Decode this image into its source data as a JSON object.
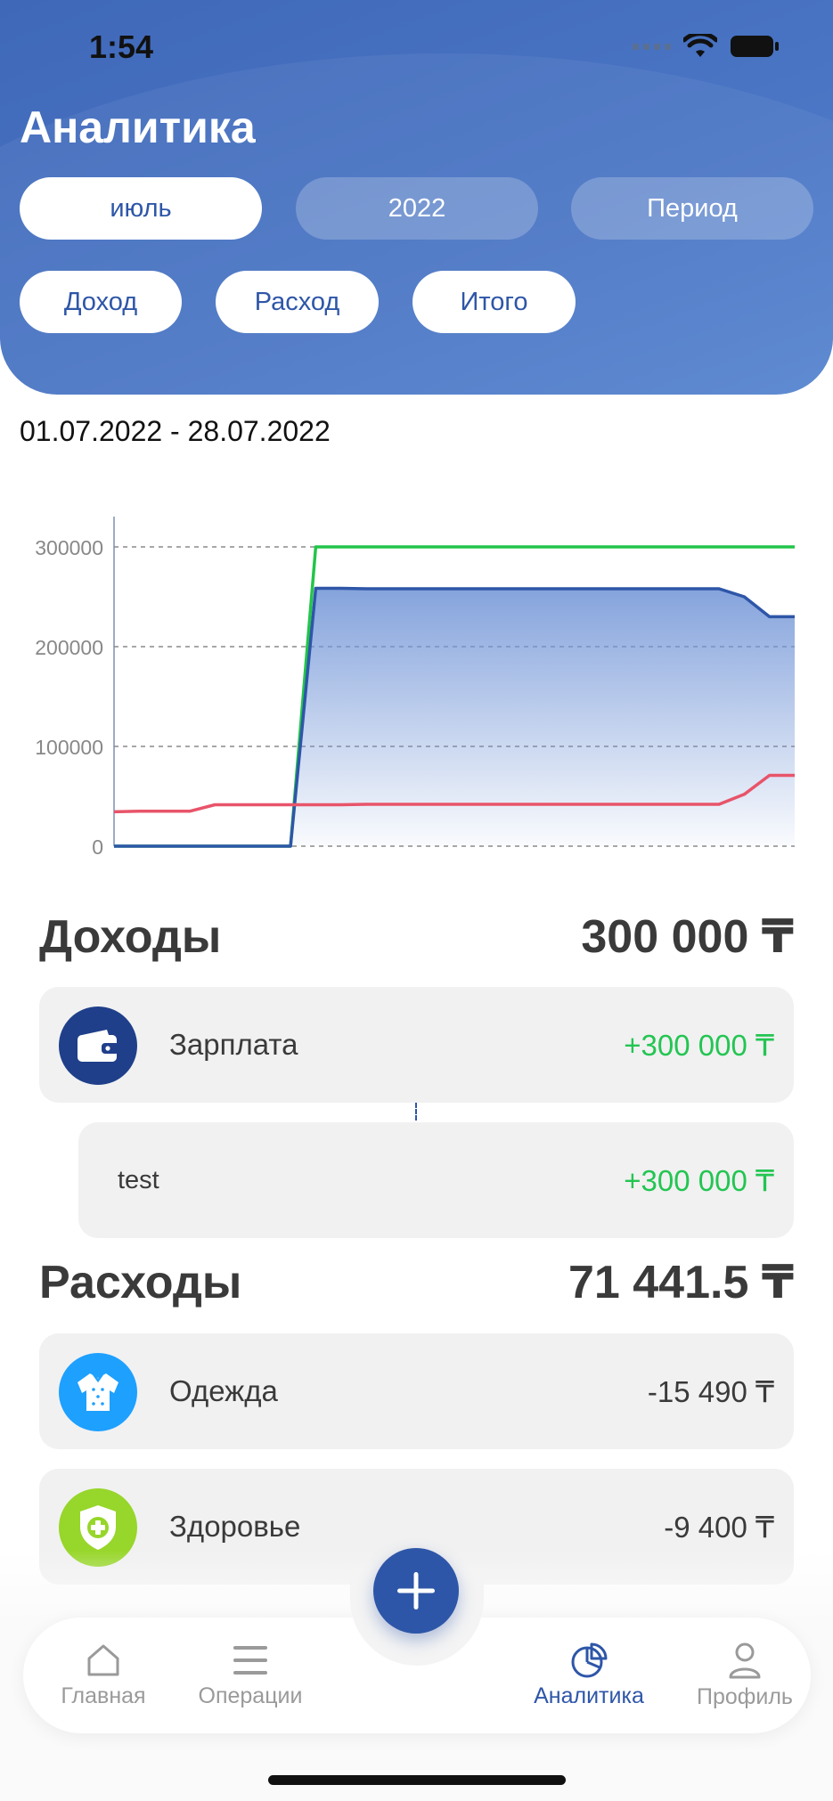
{
  "status_bar": {
    "time": "1:54"
  },
  "header": {
    "title": "Аналитика",
    "filters": {
      "month": "июль",
      "year": "2022",
      "period": "Период"
    },
    "types": {
      "income": "Доход",
      "expense": "Расход",
      "total": "Итого"
    }
  },
  "date_range": "01.07.2022 - 28.07.2022",
  "chart_data": {
    "type": "line",
    "y_ticks": [
      "300000",
      "200000",
      "100000",
      "0"
    ],
    "ylim": [
      0,
      300000
    ],
    "x": [
      1,
      2,
      3,
      4,
      5,
      6,
      7,
      8,
      9,
      10,
      11,
      12,
      13,
      14,
      15,
      16,
      17,
      18,
      19,
      20,
      21,
      22,
      23,
      24,
      25,
      26,
      27,
      28
    ],
    "series": [
      {
        "color": "#22c54a",
        "values": [
          0,
          0,
          0,
          0,
          0,
          0,
          0,
          0,
          300000,
          300000,
          300000,
          300000,
          300000,
          300000,
          300000,
          300000,
          300000,
          300000,
          300000,
          300000,
          300000,
          300000,
          300000,
          300000,
          300000,
          300000,
          300000,
          300000
        ]
      },
      {
        "color": "#2e56a8",
        "fill": true,
        "values": [
          0,
          0,
          0,
          0,
          0,
          0,
          0,
          0,
          258500,
          258500,
          258000,
          258000,
          258000,
          258000,
          258000,
          258000,
          258000,
          258000,
          258000,
          258000,
          258000,
          258000,
          258000,
          258000,
          258000,
          250000,
          230000,
          230000
        ]
      },
      {
        "color": "#e8546a",
        "values": [
          34500,
          35000,
          35000,
          35000,
          41500,
          41500,
          41500,
          41500,
          41500,
          41500,
          42000,
          42000,
          42000,
          42000,
          42000,
          42000,
          42000,
          42000,
          42000,
          42000,
          42000,
          42000,
          42000,
          42000,
          42000,
          52000,
          71000,
          71000
        ]
      }
    ],
    "grid": true
  },
  "income": {
    "title": "Доходы",
    "total": "300 000 ₸",
    "items": [
      {
        "label": "Зарплата",
        "amount": "+300 000 ₸",
        "icon": "wallet-icon",
        "icon_bg": "#1f3f8a"
      }
    ],
    "sub_items": [
      {
        "label": "test",
        "amount": "+300 000 ₸"
      }
    ]
  },
  "expenses": {
    "title": "Расходы",
    "total": "71 441.5 ₸",
    "items": [
      {
        "label": "Одежда",
        "amount": "-15 490 ₸",
        "icon": "sweater-icon",
        "icon_bg": "#1ea0ff"
      },
      {
        "label": "Здоровье",
        "amount": "-9 400 ₸",
        "icon": "health-shield-icon",
        "icon_bg": "#97d62a"
      }
    ]
  },
  "tabbar": {
    "home": "Главная",
    "operations": "Операции",
    "analytics": "Аналитика",
    "profile": "Профиль"
  },
  "colors": {
    "accent": "#2e56a8",
    "positive": "#23c552"
  }
}
